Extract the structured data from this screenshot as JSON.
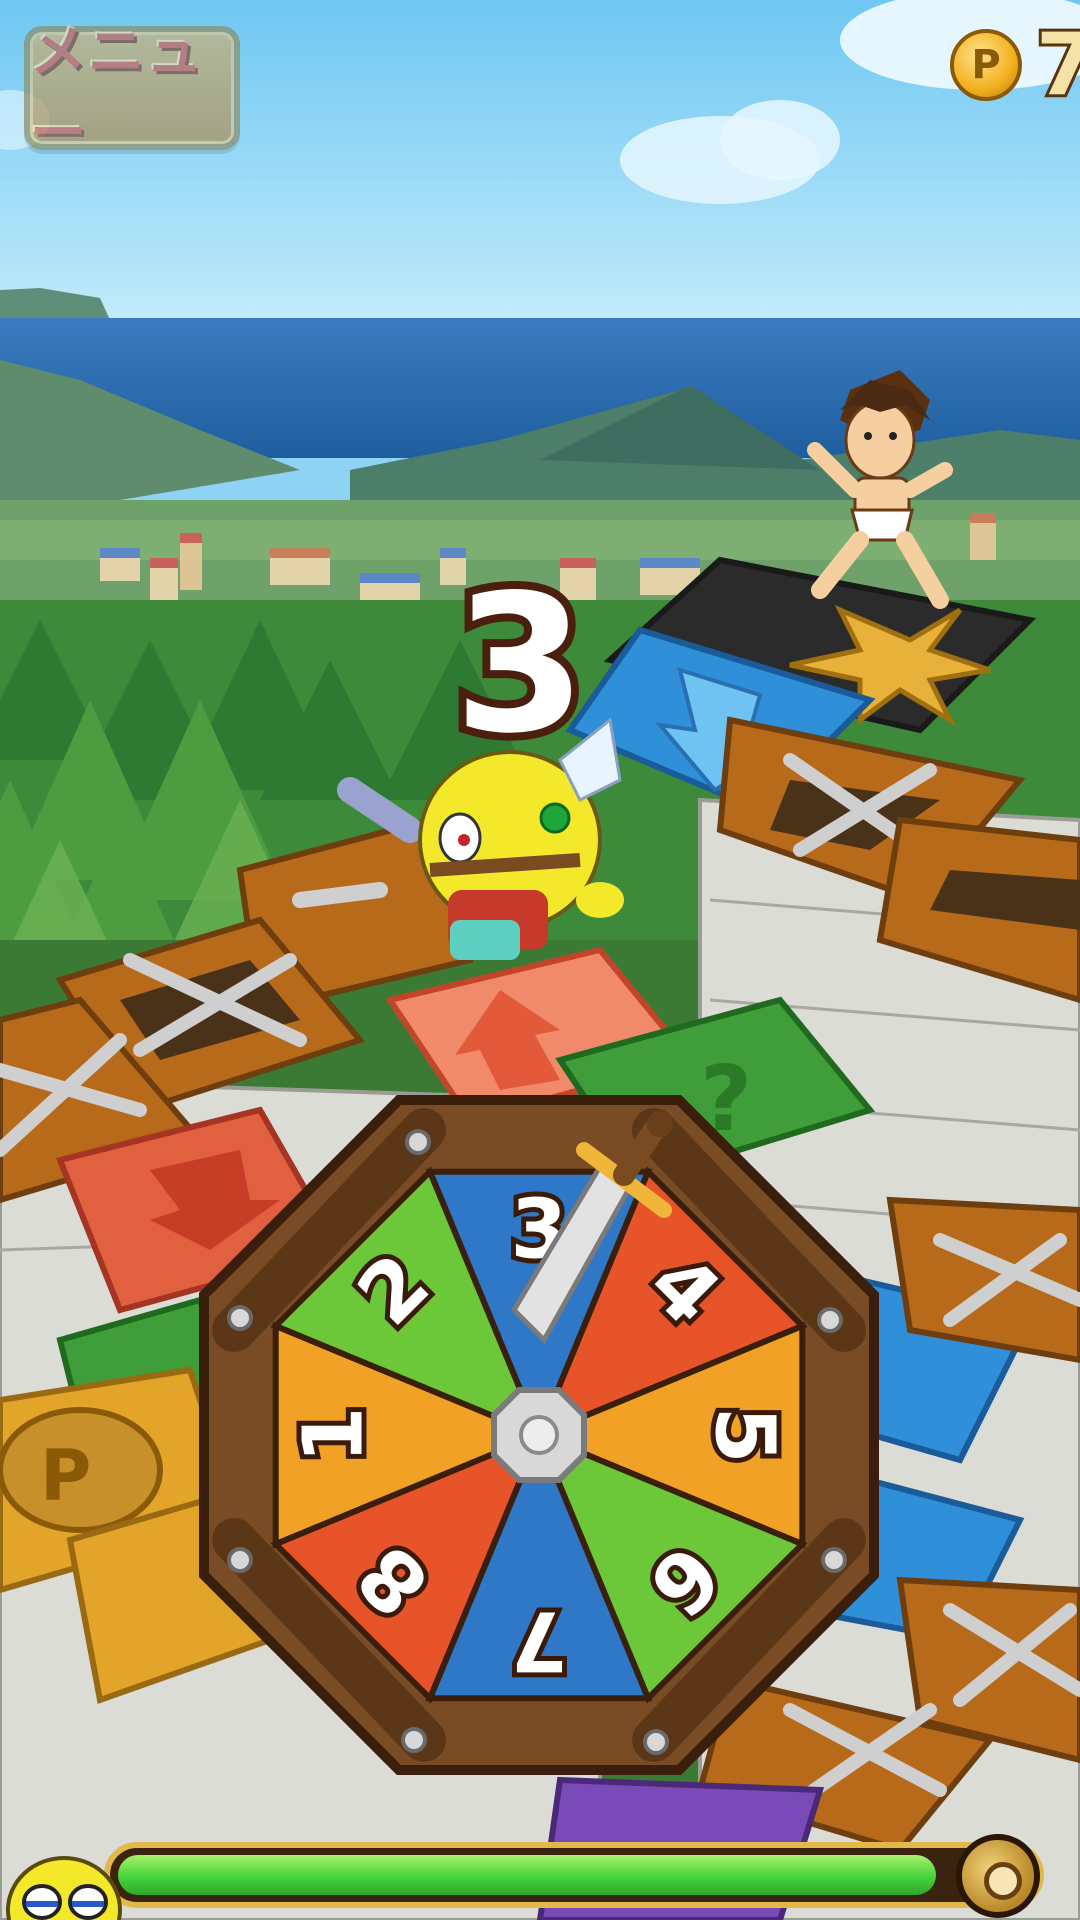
{
  "hud": {
    "menu_label": "メニュー",
    "coin_symbol": "P",
    "coin_count": "7",
    "move_number": "3"
  },
  "roulette": {
    "segments": [
      {
        "label": "3",
        "color": "#2f78c8"
      },
      {
        "label": "4",
        "color": "#e8542a"
      },
      {
        "label": "5",
        "color": "#f0a126"
      },
      {
        "label": "6",
        "color": "#6cc838"
      },
      {
        "label": "7",
        "color": "#2f78c8"
      },
      {
        "label": "8",
        "color": "#e8542a"
      },
      {
        "label": "1",
        "color": "#f0a126"
      },
      {
        "label": "2",
        "color": "#6cc838"
      }
    ]
  },
  "energy": {
    "level_percent": 96
  },
  "colors": {
    "sky_top": "#7fd0f5",
    "sea": "#2a6fb0",
    "wood": "#6e4424",
    "tile_battle": "#b66a1a",
    "tile_down": "#2f8fd8",
    "tile_up": "#e06040",
    "tile_question": "#3f9e3a",
    "tile_coin": "#e2a52a"
  },
  "icons": [
    "menu-button",
    "p-coin-icon",
    "crossed-swords-icon",
    "down-arrow-icon",
    "up-arrow-icon",
    "question-icon",
    "sword-pointer-icon",
    "paw-hub-icon"
  ]
}
